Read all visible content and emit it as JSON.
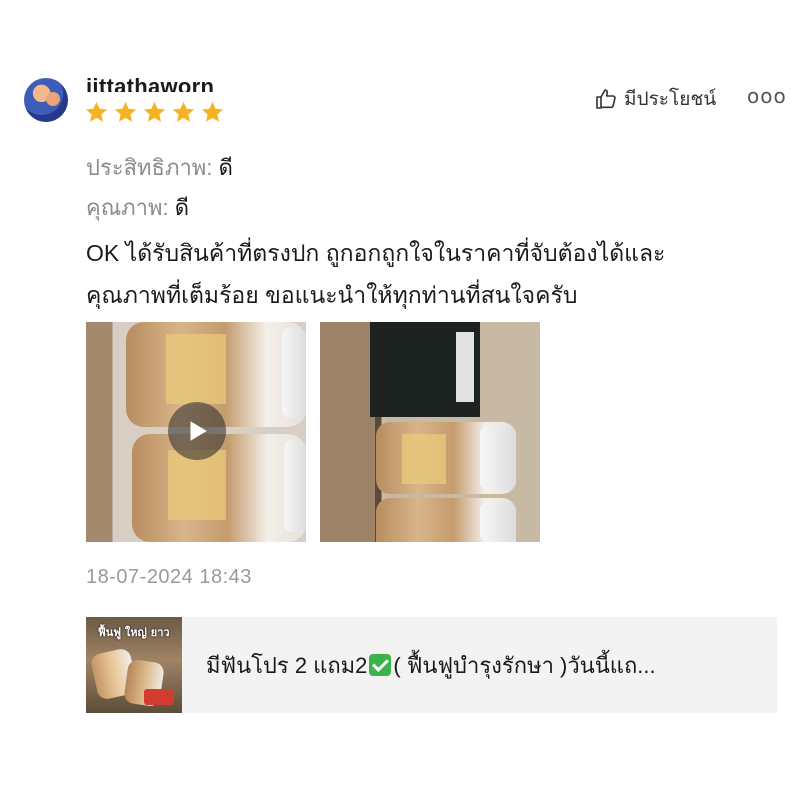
{
  "review": {
    "username": "jittathaworn",
    "rating": 5,
    "rating_max": 5,
    "helpful_label": "มีประโยชน์",
    "more_label": "ooo",
    "attributes": [
      {
        "key": "ประสิทธิภาพ:",
        "value": "ดี"
      },
      {
        "key": "คุณภาพ:",
        "value": "ดี"
      }
    ],
    "comment_line1": "OK ได้รับสินค้าที่ตรงปก ถูกอกถูกใจในราคาที่จับต้องได้และ",
    "comment_line2": "คุณภาพที่เต็มร้อย ขอแนะนำให้ทุกท่านที่สนใจครับ",
    "media": [
      {
        "kind": "video",
        "icon": "play-icon"
      },
      {
        "kind": "image"
      }
    ],
    "timestamp": "18-07-2024 18:43"
  },
  "product": {
    "title_part1": "มีฟันโปร 2 แถม2",
    "title_emoji_icon": "check-mark-icon",
    "title_part2": "( ฟื้นฟูบำรุงรักษา )วันนี้แถ...",
    "thumb_text": "ฟื้นฟู ใหญ่ ยาว"
  },
  "colors": {
    "star": "#f5b323",
    "muted_text": "#8c8c8c",
    "product_bg": "#f3f3f3",
    "check_green": "#3db24b"
  }
}
